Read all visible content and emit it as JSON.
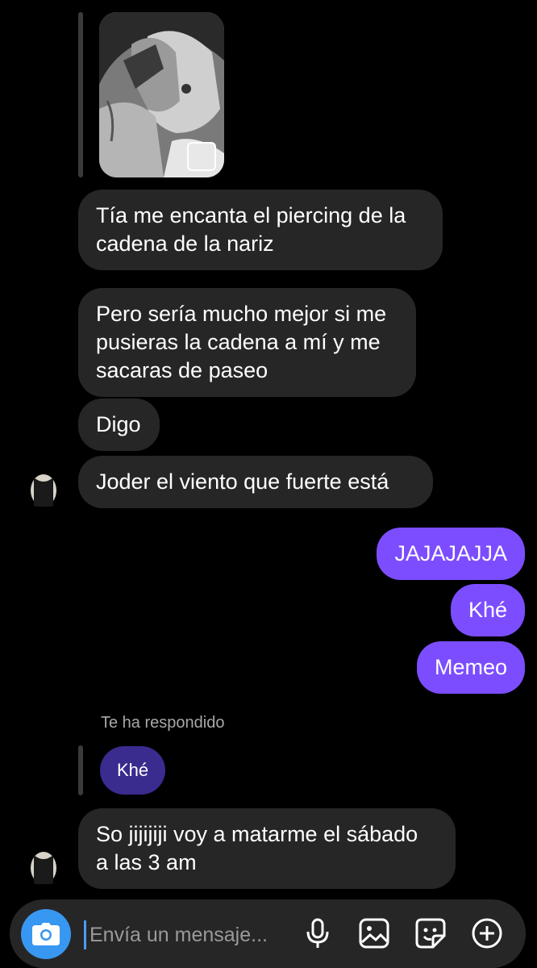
{
  "messages": {
    "m1": "Tía me encanta el piercing de la\ncadena de la nariz",
    "m2": "Pero sería mucho mejor si me\npusieras la cadena a mí y me\nsacaras de paseo",
    "m3": "Digo",
    "m4": "Joder el viento que fuerte está",
    "o1": "JAJAJAJJA",
    "o2": "Khé",
    "o3": "Memeo",
    "reply_label": "Te ha respondido",
    "reply_quote": "Khé",
    "m5": "So jijijiji voy a matarme el sábado\na las 3 am"
  },
  "composer": {
    "placeholder": "Envía un mensaje..."
  },
  "icons": [
    "camera-icon",
    "microphone-icon",
    "gallery-icon",
    "sticker-icon",
    "plus-icon"
  ],
  "colors": {
    "incoming_bubble": "#262626",
    "outgoing_bubble": "#7c4dff",
    "reply_quote_bubble": "#3a2b8f",
    "camera_button": "#3897f0"
  }
}
